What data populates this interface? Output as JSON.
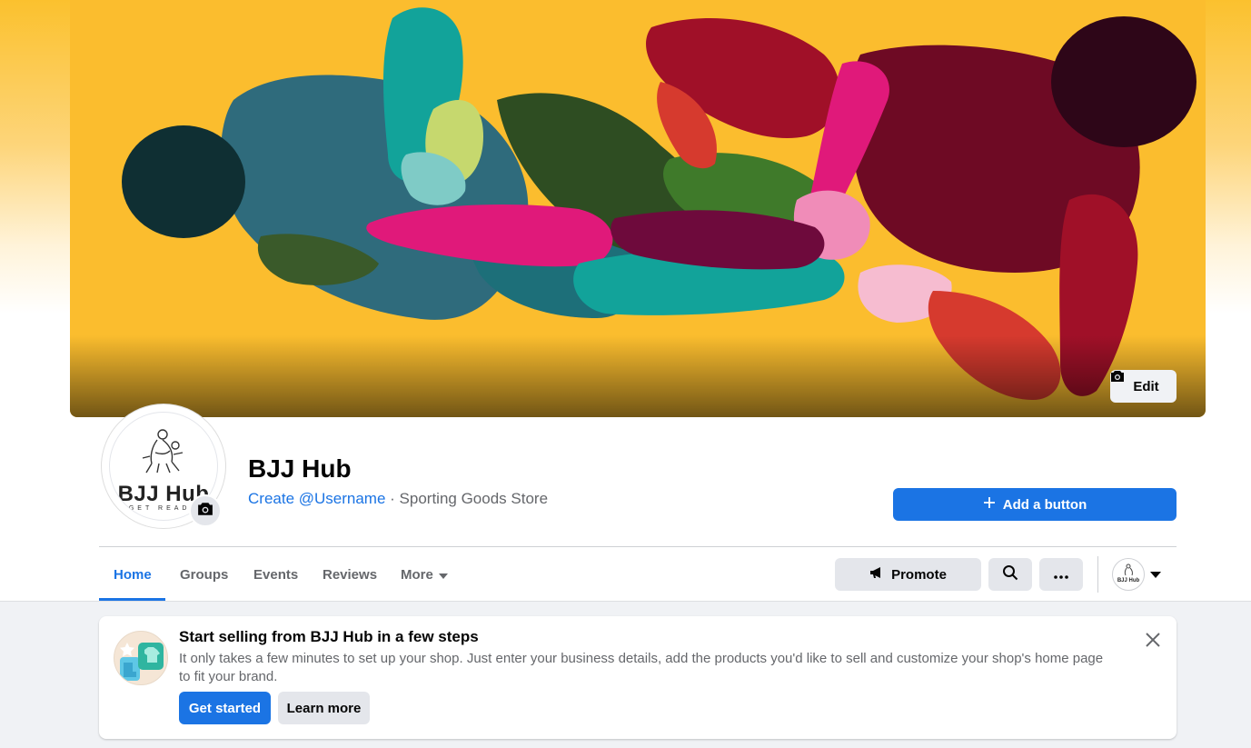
{
  "cover": {
    "edit_label": "Edit",
    "icon": "camera-icon"
  },
  "profile": {
    "avatar_title": "BJJ Hub",
    "avatar_subtitle": "GET READY",
    "name": "BJJ Hub",
    "username_link": "Create @Username",
    "separator": " · ",
    "category": "Sporting Goods Store",
    "add_button_label": "Add a button",
    "add_button_icon": "plus-icon"
  },
  "tabs": [
    {
      "label": "Home",
      "active": true
    },
    {
      "label": "Groups",
      "active": false
    },
    {
      "label": "Events",
      "active": false
    },
    {
      "label": "Reviews",
      "active": false
    },
    {
      "label": "More",
      "active": false
    }
  ],
  "actions": {
    "promote_label": "Promote",
    "promote_icon": "megaphone-icon",
    "search_icon": "search-icon",
    "more_icon": "ellipsis-icon",
    "mini_avatar_text": "BJJ Hub"
  },
  "shop_card": {
    "title": "Start selling from BJJ Hub in a few steps",
    "body": "It only takes a few minutes to set up your shop. Just enter your business details, add the products you'd like to sell and customize your shop's home page to fit your brand.",
    "primary_label": "Get started",
    "secondary_label": "Learn more",
    "close_icon": "close-icon"
  },
  "colors": {
    "accent": "#1b74e4",
    "cover_background": "#fbbd2e"
  }
}
